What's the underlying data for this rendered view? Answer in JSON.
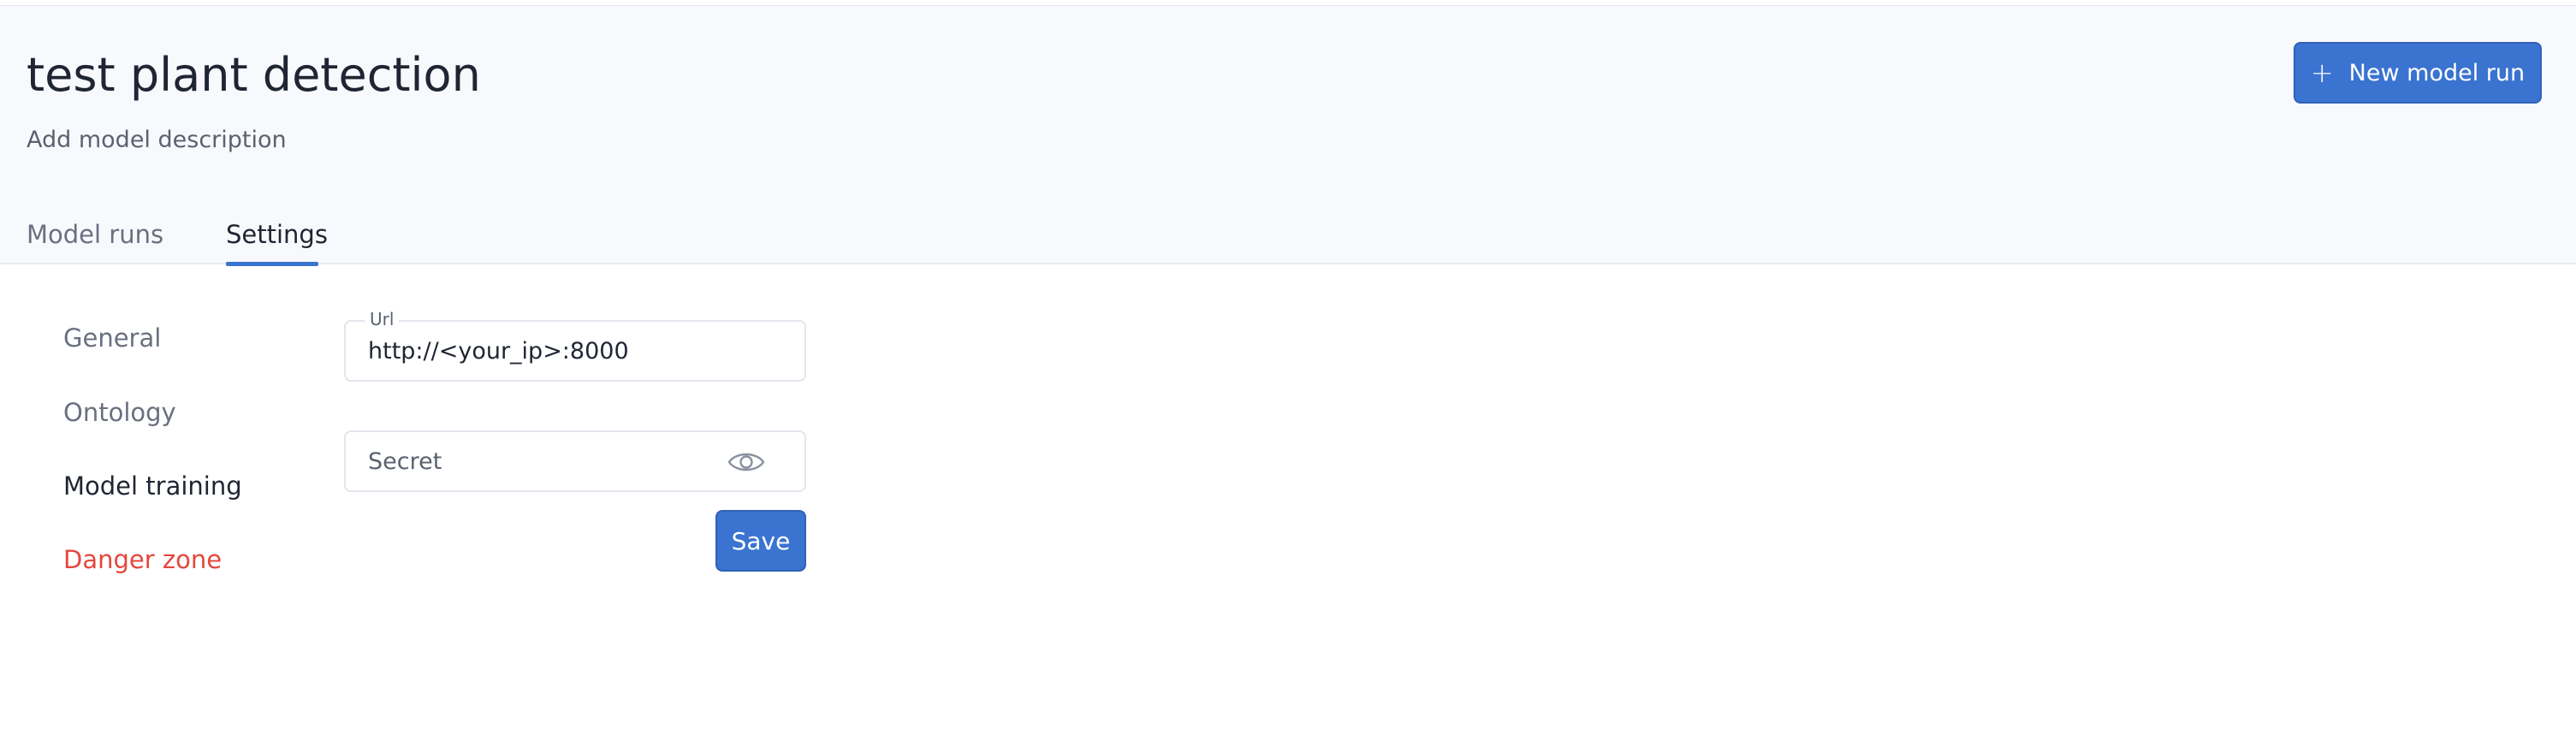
{
  "header": {
    "title": "test plant detection",
    "description_link": "Add model description",
    "new_run_label": "New model run",
    "new_run_icon": "plus-icon"
  },
  "tabs": [
    {
      "label": "Model runs",
      "active": false
    },
    {
      "label": "Settings",
      "active": true
    }
  ],
  "settings_nav": [
    {
      "label": "General",
      "active": false
    },
    {
      "label": "Ontology",
      "active": false
    },
    {
      "label": "Model training",
      "active": true
    },
    {
      "label": "Danger zone",
      "active": false
    }
  ],
  "form": {
    "url_label": "Url",
    "url_value": "http://<your_ip>:8000",
    "secret_placeholder": "Secret",
    "secret_icon": "eye-icon",
    "save_label": "Save"
  },
  "colors": {
    "accent": "#3a73d0",
    "danger": "#e4473d",
    "header_bg": "#f8f9fc"
  }
}
